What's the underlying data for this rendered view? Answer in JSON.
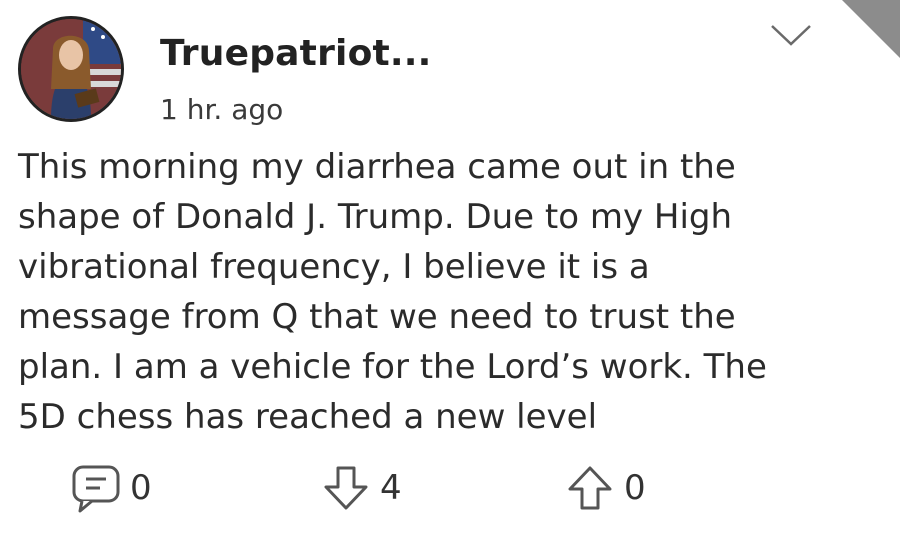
{
  "post": {
    "author": "Truepatriot...",
    "time": "1 hr. ago",
    "body": "This morning my diarrhea came out in the\nshape of Donald J. Trump. Due to my High\nvibrational frequency, I believe it is a\nmessage from Q that we need to trust the\nplan. I am a vehicle for the Lord’s work. The\n5D chess has reached a new level"
  },
  "actions": {
    "comments": "0",
    "downvotes": "4",
    "upvotes": "0"
  },
  "icons": {
    "avatar": "profile-photo",
    "menu": "chevron-down-icon",
    "comment": "comment-icon",
    "downvote": "arrow-down-icon",
    "upvote": "arrow-up-icon"
  },
  "colors": {
    "text": "#2b2b2b",
    "corner": "#8c8c8c"
  }
}
